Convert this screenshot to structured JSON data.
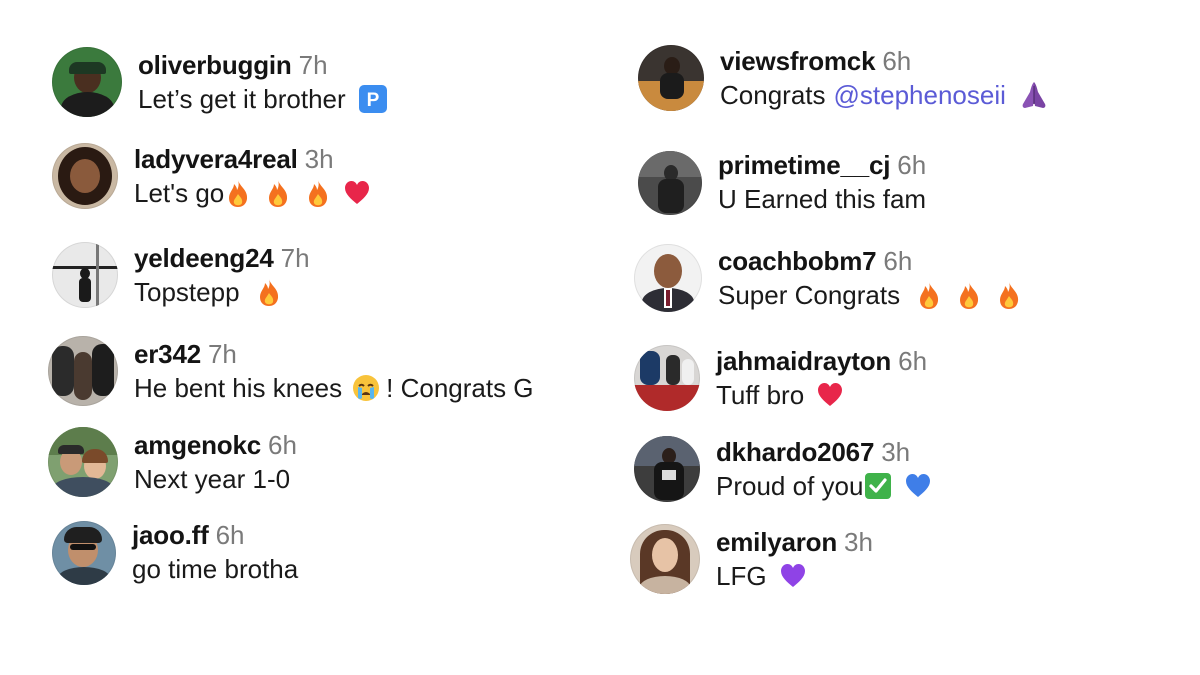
{
  "comments": [
    {
      "username": "oliverbuggin",
      "time": "7h",
      "text": "Let’s get it brother",
      "emojis": [
        "parking-sign"
      ]
    },
    {
      "username": "ladyvera4real",
      "time": "3h",
      "text": "Let's go",
      "emojis": [
        "fire",
        "fire",
        "fire",
        "red-heart"
      ]
    },
    {
      "username": "yeldeeng24",
      "time": "7h",
      "text": "Topstepp",
      "emojis": [
        "fire"
      ]
    },
    {
      "username": "er342",
      "time": "7h",
      "text_before": "He bent his knees",
      "text_after": "! Congrats G",
      "emojis": [
        "crying-face"
      ]
    },
    {
      "username": "amgenokc",
      "time": "6h",
      "text": "Next year 1-0"
    },
    {
      "username": "jaoo.ff",
      "time": "6h",
      "text": "go time brotha"
    },
    {
      "username": "viewsfromck",
      "time": "6h",
      "text": "Congrats",
      "mention": "@stephenoseii",
      "emojis": [
        "folded-hands"
      ]
    },
    {
      "username": "primetime__cj",
      "time": "6h",
      "text": "U Earned this fam"
    },
    {
      "username": "coachbobm7",
      "time": "6h",
      "text": "Super Congrats",
      "emojis": [
        "fire",
        "fire",
        "fire"
      ]
    },
    {
      "username": "jahmaidrayton",
      "time": "6h",
      "text": "Tuff bro",
      "emojis": [
        "red-heart"
      ]
    },
    {
      "username": "dkhardo2067",
      "time": "3h",
      "text": "Proud of you",
      "emojis": [
        "check-mark",
        "blue-heart"
      ]
    },
    {
      "username": "emilyaron",
      "time": "3h",
      "text": "LFG",
      "emojis": [
        "purple-heart"
      ]
    }
  ],
  "colors": {
    "text": "#141414",
    "time": "#7a7a7a",
    "mention": "#5b5bd6",
    "fire": "#f4711f",
    "red_heart": "#e8264a",
    "blue_heart": "#3f7ee8",
    "purple_heart": "#8f43e6",
    "check_green": "#3fb24a",
    "parking_blue": "#3b8df0",
    "folded_hands": "#8a52b4"
  }
}
